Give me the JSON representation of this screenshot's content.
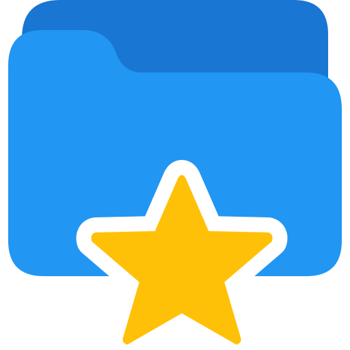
{
  "icon": {
    "name": "favorite-folder-icon",
    "parts": {
      "folder": "folder-icon",
      "star": "star-icon"
    },
    "colors": {
      "folder_back": "#1976D2",
      "folder_front": "#2196F3",
      "star_fill": "#FFC107",
      "star_outline": "#FFFFFF",
      "background": "#FFFFFF"
    }
  }
}
